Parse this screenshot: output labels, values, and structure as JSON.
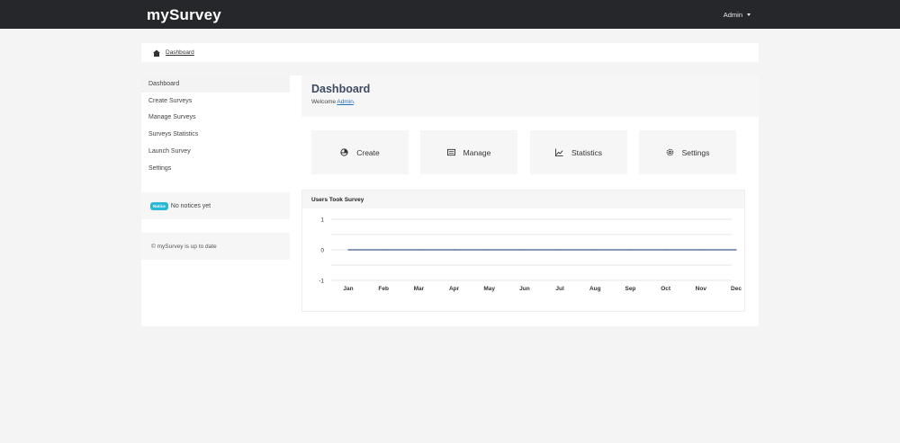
{
  "brand": "mySurvey",
  "user_menu": {
    "label": "Admin"
  },
  "breadcrumb": {
    "label": "Dashboard"
  },
  "sidebar": {
    "items": [
      {
        "label": "Dashboard"
      },
      {
        "label": "Create Surveys"
      },
      {
        "label": "Manage Surveys"
      },
      {
        "label": "Surveys Statistics"
      },
      {
        "label": "Launch Survey"
      },
      {
        "label": "Settings"
      }
    ],
    "notice_badge": "Notice",
    "notice_text": "No notices yet",
    "status_text": "© mySurvey is up to date"
  },
  "main": {
    "title": "Dashboard",
    "welcome_prefix": "Welcome ",
    "welcome_user": "Admin",
    "welcome_suffix": ".",
    "tiles": [
      {
        "label": "Create",
        "icon": "pie-chart-icon"
      },
      {
        "label": "Manage",
        "icon": "list-icon"
      },
      {
        "label": "Statistics",
        "icon": "line-chart-icon"
      },
      {
        "label": "Settings",
        "icon": "gear-icon"
      }
    ],
    "panel_title": "Users Took Survey"
  },
  "colors": {
    "navbar": "#25272b",
    "accent": "#2bb8d6",
    "title": "#3d4a62",
    "series": "#3c5a8a"
  },
  "chart_data": {
    "type": "line",
    "categories": [
      "Jan",
      "Feb",
      "Mar",
      "Apr",
      "May",
      "Jun",
      "Jul",
      "Aug",
      "Sep",
      "Oct",
      "Nov",
      "Dec"
    ],
    "series": [
      {
        "values": [
          0,
          0,
          0,
          0,
          0,
          0,
          0,
          0,
          0,
          0,
          0,
          0
        ]
      }
    ],
    "yticks": [
      1,
      0,
      -1
    ],
    "ylim": [
      -1,
      1
    ],
    "grid": true,
    "legend": "none"
  }
}
